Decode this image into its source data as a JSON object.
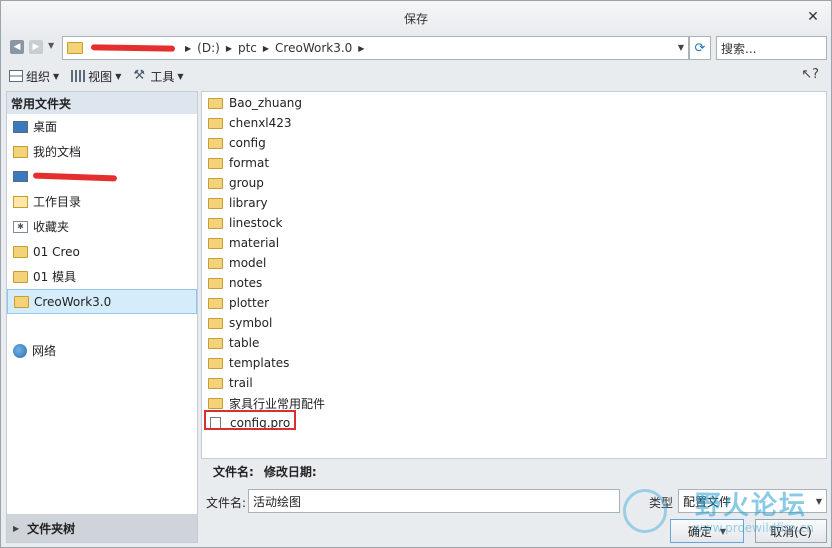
{
  "window": {
    "title": "保存"
  },
  "nav": {
    "address": {
      "segments": [
        "(D:)",
        "ptc",
        "CreoWork3.0"
      ]
    },
    "search_placeholder": "搜索..."
  },
  "toolbar": {
    "organize_label": "组织",
    "view_label": "视图",
    "tools_label": "工具"
  },
  "sidebar": {
    "header": "常用文件夹",
    "items": [
      {
        "label": "桌面",
        "icon": "desktop-icon"
      },
      {
        "label": "我的文档",
        "icon": "documents-icon"
      },
      {
        "label": "",
        "icon": "computer-icon"
      },
      {
        "label": "工作目录",
        "icon": "working-directory-icon"
      },
      {
        "label": "收藏夹",
        "icon": "favorites-icon"
      },
      {
        "label": "01 Creo",
        "icon": "folder-icon"
      },
      {
        "label": "01 模具",
        "icon": "folder-icon"
      },
      {
        "label": "CreoWork3.0",
        "icon": "folder-icon",
        "selected": true
      }
    ],
    "network_label": "网络",
    "folder_tree_label": "文件夹树"
  },
  "files": [
    {
      "name": "Bao_zhuang",
      "type": "folder"
    },
    {
      "name": "chenxl423",
      "type": "folder"
    },
    {
      "name": "config",
      "type": "folder"
    },
    {
      "name": "format",
      "type": "folder"
    },
    {
      "name": "group",
      "type": "folder"
    },
    {
      "name": "library",
      "type": "folder"
    },
    {
      "name": "linestock",
      "type": "folder"
    },
    {
      "name": "material",
      "type": "folder"
    },
    {
      "name": "model",
      "type": "folder"
    },
    {
      "name": "notes",
      "type": "folder"
    },
    {
      "name": "plotter",
      "type": "folder"
    },
    {
      "name": "symbol",
      "type": "folder"
    },
    {
      "name": "table",
      "type": "folder"
    },
    {
      "name": "templates",
      "type": "folder"
    },
    {
      "name": "trail",
      "type": "folder"
    },
    {
      "name": "家具行业常用配件",
      "type": "folder"
    },
    {
      "name": "config.pro",
      "type": "file",
      "highlighted": true
    }
  ],
  "details": {
    "filename_label": "文件名:",
    "modified_label": "修改日期:"
  },
  "bottom": {
    "filename_label": "文件名:",
    "filename_value": "活动绘图",
    "type_label": "类型",
    "type_value": "配置文件",
    "ok_label": "确定",
    "cancel_label": "取消(C)"
  },
  "watermark": {
    "brand": "野火论坛",
    "site": "www.proewildfire.cn"
  },
  "colors": {
    "accent": "#2a73b8",
    "selected_bg": "#d5ecfb",
    "highlight_border": "#d8302f",
    "folder": "#f3d27a"
  }
}
